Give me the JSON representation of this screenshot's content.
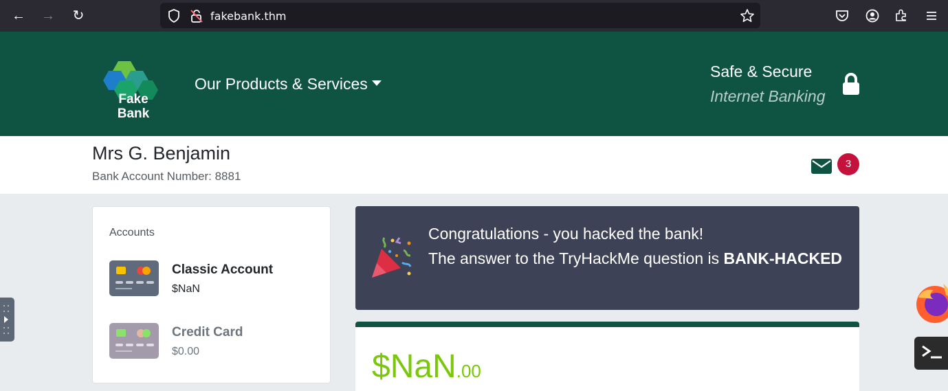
{
  "browser": {
    "url": "fakebank.thm"
  },
  "header": {
    "logo_line1": "Fake",
    "logo_line2": "Bank",
    "products_menu": "Our Products & Services",
    "safe_title": "Safe & Secure",
    "safe_subtitle": "Internet Banking"
  },
  "customer": {
    "name": "Mrs G. Benjamin",
    "account_number": "Bank Account Number: 8881",
    "message_count": "3"
  },
  "accounts": {
    "heading": "Accounts",
    "items": [
      {
        "name": "Classic Account",
        "balance": "$NaN"
      },
      {
        "name": "Credit Card",
        "balance": "$0.00"
      }
    ]
  },
  "congrats": {
    "line1": "Congratulations - you hacked the bank!",
    "line2_prefix": "The answer to the TryHackMe question is ",
    "answer": "BANK-HACKED"
  },
  "balance": {
    "main": "$NaN",
    "cents": ".00"
  },
  "colors": {
    "brand_green": "#0f5443",
    "balance_green": "#7ac70c",
    "badge_red": "#c5123d",
    "panel_dark": "#3e4257"
  }
}
